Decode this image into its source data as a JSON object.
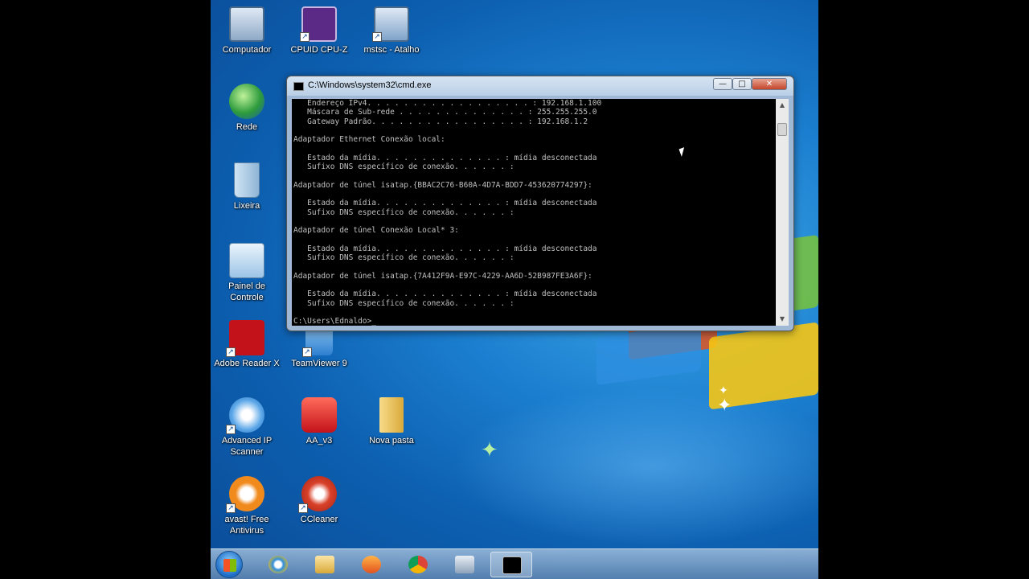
{
  "desktop": {
    "icons": [
      {
        "label": "Computador"
      },
      {
        "label": "CPUID CPU-Z"
      },
      {
        "label": "mstsc - Atalho"
      },
      {
        "label": "Rede"
      },
      {
        "label": "Lixeira"
      },
      {
        "label": "Painel de Controle"
      },
      {
        "label": "Adobe Reader X"
      },
      {
        "label": "TeamViewer 9"
      },
      {
        "label": "Advanced IP Scanner"
      },
      {
        "label": "AA_v3"
      },
      {
        "label": "Nova pasta"
      },
      {
        "label": "avast! Free Antivirus"
      },
      {
        "label": "CCleaner"
      }
    ]
  },
  "cmd_window": {
    "title": "C:\\Windows\\system32\\cmd.exe",
    "lines": [
      "   Endereço IPv4. . . . . . . . . . . . . . . . . . : 192.168.1.100",
      "   Máscara de Sub-rede . . . . . . . . . . . . . . : 255.255.255.0",
      "   Gateway Padrão. . . . . . . . . . . . . . . . . : 192.168.1.2",
      "",
      "Adaptador Ethernet Conexão local:",
      "",
      "   Estado da mídia. . . . . . . . . . . . . . : mídia desconectada",
      "   Sufixo DNS específico de conexão. . . . . . :",
      "",
      "Adaptador de túnel isatap.{BBAC2C76-B60A-4D7A-BDD7-453620774297}:",
      "",
      "   Estado da mídia. . . . . . . . . . . . . . : mídia desconectada",
      "   Sufixo DNS específico de conexão. . . . . . :",
      "",
      "Adaptador de túnel Conexão Local* 3:",
      "",
      "   Estado da mídia. . . . . . . . . . . . . . : mídia desconectada",
      "   Sufixo DNS específico de conexão. . . . . . :",
      "",
      "Adaptador de túnel isatap.{7A412F9A-E97C-4229-AA6D-52B987FE3A6F}:",
      "",
      "   Estado da mídia. . . . . . . . . . . . . . : mídia desconectada",
      "   Sufixo DNS específico de conexão. . . . . . :",
      "",
      "C:\\Users\\Ednaldo>_"
    ],
    "buttons": {
      "minimize": "—",
      "maximize": "□",
      "close": "✕"
    }
  },
  "taskbar": {
    "items": [
      {
        "icon": "internet-explorer-icon"
      },
      {
        "icon": "windows-explorer-icon"
      },
      {
        "icon": "media-player-icon"
      },
      {
        "icon": "chrome-icon"
      },
      {
        "icon": "camera-icon"
      },
      {
        "icon": "cmd-icon",
        "active": true
      }
    ]
  },
  "colors": {
    "console_bg": "#000000",
    "console_text": "#c0c0c0",
    "desktop_blue": "#1c7fd0"
  }
}
